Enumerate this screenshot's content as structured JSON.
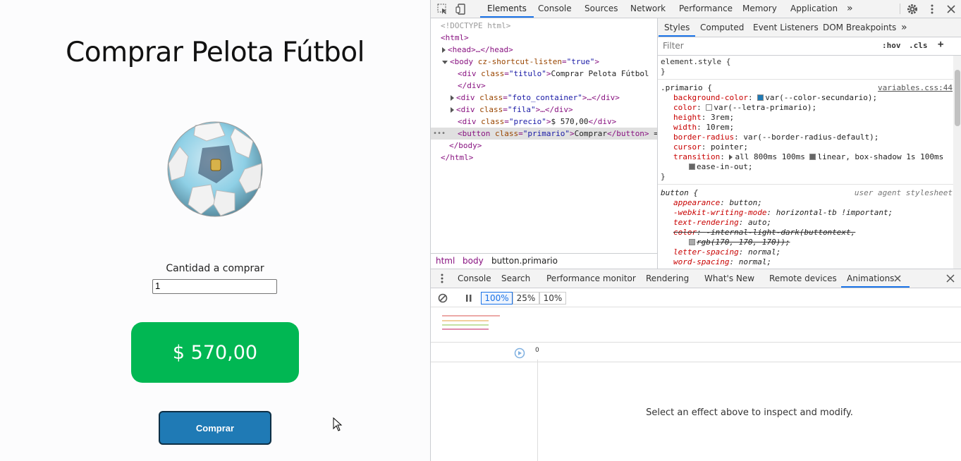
{
  "page": {
    "title": "Comprar Pelota Fútbol",
    "quantity_label": "Cantidad a comprar",
    "quantity_value": "1",
    "price": "$ 570,00",
    "buy_button": "Comprar",
    "colors": {
      "price_bg": "#01b753",
      "button_bg": "#1f7ab5"
    }
  },
  "devtools": {
    "main_tabs": [
      "Elements",
      "Console",
      "Sources",
      "Network",
      "Performance",
      "Memory",
      "Application"
    ],
    "more_tabs": "»",
    "elements_tree": {
      "doctype": "<!DOCTYPE html>",
      "html_open": "<html>",
      "head": "<head>…</head>",
      "body_open_tag": "<body",
      "body_attr_name": "cz-shortcut-listen",
      "body_attr_value": "\"true\"",
      "div": "<div",
      "class_attr": "class",
      "titulo_value": "\"titulo\"",
      "titulo_text": "Comprar Pelota Fútbol",
      "close_div": "</div>",
      "foto_value": "\"foto_container\"",
      "fila_value": "\"fila\"",
      "precio_value": "\"precio\"",
      "precio_text": "$ 570,00",
      "button_open": "<button",
      "primario_value": "\"primario\"",
      "button_text": "Comprar",
      "button_close": "</button>",
      "eq": "==",
      "body_close": "</body>",
      "html_close": "</html>",
      "ellipsis_close": ">…</div>"
    },
    "breadcrumbs": [
      "html",
      "body",
      "button.primario"
    ],
    "styles_tabs": [
      "Styles",
      "Computed",
      "Event Listeners",
      "DOM Breakpoints"
    ],
    "filter_placeholder": "Filter",
    "filter_buttons": [
      ":hov",
      ".cls",
      "+"
    ],
    "element_style": "element.style {",
    "close_brace": "}",
    "rule_primario": {
      "selector": ".primario {",
      "source": "variables.css:44",
      "props": [
        {
          "name": "background-color",
          "value": "var(--color-secundario);",
          "swatch": "#1f7ab5"
        },
        {
          "name": "color",
          "value": "var(--letra-primario);",
          "swatch": "#ffffff"
        },
        {
          "name": "height",
          "value": "3rem;"
        },
        {
          "name": "width",
          "value": "10rem;"
        },
        {
          "name": "border-radius",
          "value": "var(--border-radius-default);"
        },
        {
          "name": "cursor",
          "value": "pointer;"
        },
        {
          "name": "transition",
          "value": "all 800ms 100ms",
          "value2": "linear, box-shadow 1s 100ms",
          "value3": "ease-in-out;"
        }
      ]
    },
    "rule_button": {
      "selector": "button {",
      "source": "user agent stylesheet",
      "props": [
        {
          "name": "appearance",
          "value": "button;"
        },
        {
          "name": "-webkit-writing-mode",
          "value": "horizontal-tb !important;"
        },
        {
          "name": "text-rendering",
          "value": "auto;"
        },
        {
          "name": "color",
          "value": "-internal-light-dark(buttontext,",
          "value2": "rgb(170, 170, 170));",
          "swatch": "#aaaaaa"
        },
        {
          "name": "letter-spacing",
          "value": "normal;"
        },
        {
          "name": "word-spacing",
          "value": "normal;"
        }
      ]
    },
    "drawer_tabs": [
      "Console",
      "Search",
      "Performance monitor",
      "Rendering",
      "What's New",
      "Remote devices",
      "Animations"
    ],
    "speeds": [
      "100%",
      "25%",
      "10%"
    ],
    "timeline_zero": "0",
    "empty_message": "Select an effect above to inspect and modify."
  }
}
